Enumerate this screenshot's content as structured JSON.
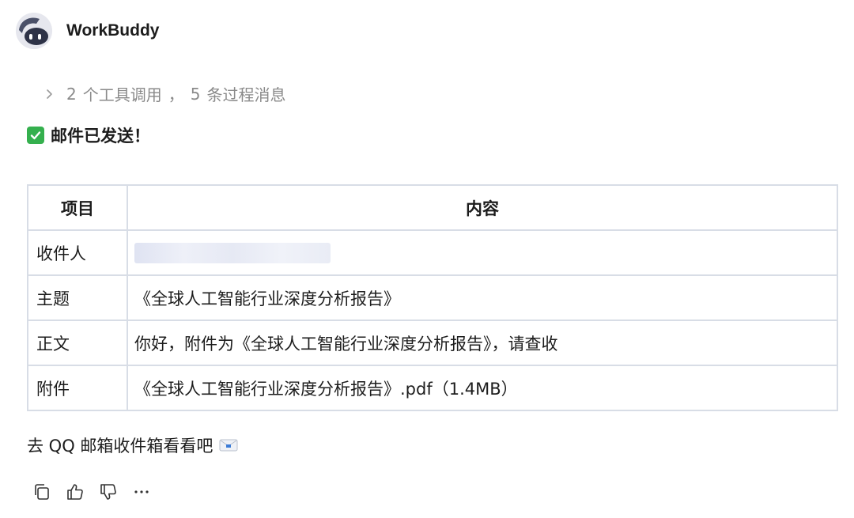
{
  "header": {
    "app_name": "WorkBuddy",
    "avatar_icon": "robot-avatar-icon"
  },
  "process": {
    "tool_calls": "2",
    "tool_calls_label": "个工具调用",
    "sep": "，",
    "messages": "5",
    "messages_label": "条过程消息"
  },
  "status": {
    "text": "邮件已发送！",
    "icon": "check-mark-icon"
  },
  "table": {
    "headers": [
      "项目",
      "内容"
    ],
    "rows": [
      {
        "label": "收件人",
        "value": ""
      },
      {
        "label": "主题",
        "value": "《全球人工智能行业深度分析报告》"
      },
      {
        "label": "正文",
        "value": "你好，附件为《全球人工智能行业深度分析报告》，请查收"
      },
      {
        "label": "附件",
        "value": "《全球人工智能行业深度分析报告》.pdf（1.4MB）"
      }
    ]
  },
  "footer": {
    "text": "去 QQ 邮箱收件箱看看吧"
  },
  "actions": [
    "copy-icon",
    "thumbs-up-icon",
    "thumbs-down-icon",
    "more-icon"
  ],
  "colors": {
    "check_green": "#35b04e",
    "border": "#d8dde6",
    "muted_text": "#8a8a8a"
  }
}
